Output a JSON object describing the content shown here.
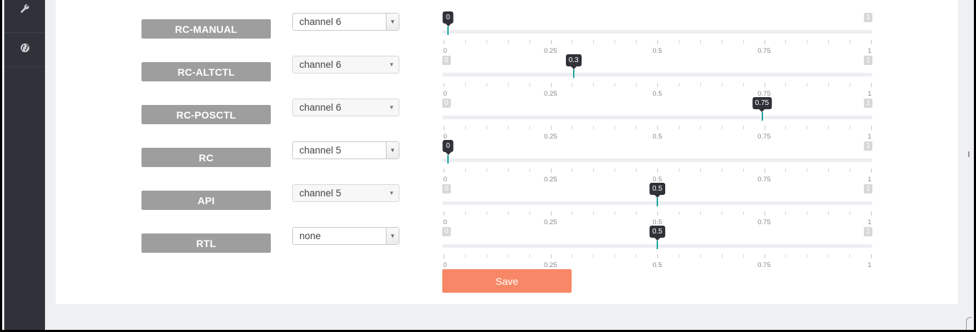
{
  "sidebar": {
    "items": [
      {
        "icon": "wrench-icon"
      },
      {
        "icon": "globe-icon"
      }
    ]
  },
  "rows": [
    {
      "label": "RC-MANUAL",
      "channel": "channel 6",
      "select_style": "boxed",
      "value": 0,
      "value_text": "0"
    },
    {
      "label": "RC-ALTCTL",
      "channel": "channel 6",
      "select_style": "plain",
      "value": 0.3,
      "value_text": "0.3"
    },
    {
      "label": "RC-POSCTL",
      "channel": "channel 6",
      "select_style": "plain",
      "value": 0.75,
      "value_text": "0.75"
    },
    {
      "label": "RC",
      "channel": "channel 5",
      "select_style": "boxed",
      "value": 0,
      "value_text": "0"
    },
    {
      "label": "API",
      "channel": "channel 5",
      "select_style": "plain",
      "value": 0.5,
      "value_text": "0.5"
    },
    {
      "label": "RTL",
      "channel": "none",
      "select_style": "boxed",
      "value": 0.5,
      "value_text": "0.5"
    }
  ],
  "slider": {
    "min_label": "0",
    "max_label": "1",
    "tick_labels": [
      "0",
      "0.25",
      "0.5",
      "0.75",
      "1"
    ]
  },
  "save_label": "Save",
  "colors": {
    "sidebar": "#2f3238",
    "label_bg": "#9e9e9e",
    "handle": "#1ea6a0",
    "save": "#f78766",
    "background": "#eef0f4"
  }
}
